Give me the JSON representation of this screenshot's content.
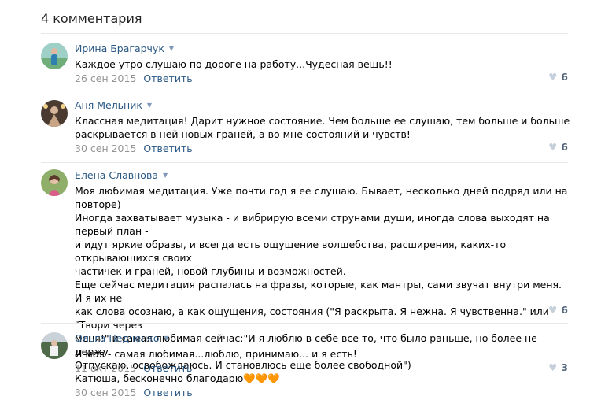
{
  "header": {
    "count_text": "4 комментария"
  },
  "reply_label": "Ответить",
  "colors": {
    "link": "#2a5885",
    "date": "#939393",
    "divider": "#e7e8ec",
    "likes": "#55677d",
    "heart": "#c5d0db"
  },
  "comments": [
    {
      "author": "Ирина Брагарчук",
      "text": "Каждое утро слушаю по дороге на работу...Чудесная вещь!!",
      "date": "26 сен 2015",
      "likes": "6",
      "avatar_icon": "avatar-photo-icon"
    },
    {
      "author": "Аня Мельник",
      "text": "Классная медитация! Дарит нужное состояние. Чем больше ее слушаю, тем больше и больше\nраскрывается в ней новых граней, а во мне состояний и чувств!",
      "date": "30 сен 2015",
      "likes": "6",
      "avatar_icon": "avatar-photo-icon"
    },
    {
      "author": "Елена Славнова",
      "text": "Моя любимая медитация. Уже почти год я ее слушаю. Бывает, несколько дней подряд или на повторе)\nИногда захватывает музыка - и вибрирую всеми струнами души, иногда слова выходят на первый план -\nи идут яркие образы, и всегда есть ощущение волшебства, расширения, каких-то открывающихся своих\nчастичек и граней, новой глубины и возможностей.\nЕще сейчас медитация распалась на фразы, которые, как мантры, сами звучат внутри меня. И я их не\nкак слова осознаю, а как ощущения, состояния (\"Я раскрыта. Я нежна. Я чувственна.\" или \"Твори через\nменя!\" и самая любимая сейчас:\"И я люблю в себе все то, что было раньше, но более не держу.\nОтпускаю, освобождаюсь. И становлюсь еще более свободной\")\nКатюша, бесконечно благодарю🧡🧡🧡",
      "date": "30 сен 2015",
      "likes": "6",
      "avatar_icon": "avatar-photo-icon"
    },
    {
      "author": "Ольга Педченко",
      "text": "И моя - самая любимая...люблю, принимаю... и я есть!",
      "date": "11 окт 2015",
      "likes": "3",
      "avatar_icon": "avatar-photo-icon"
    }
  ]
}
